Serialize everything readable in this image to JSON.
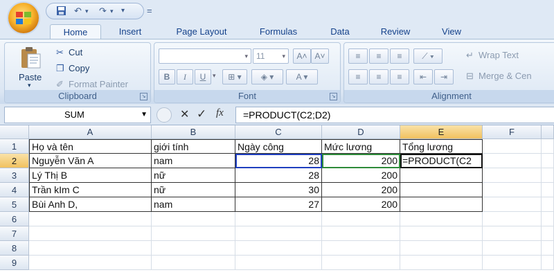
{
  "quick_access": {
    "undo": "↶",
    "redo": "↷",
    "customize": "="
  },
  "tabs": [
    {
      "label": "Home",
      "active": true
    },
    {
      "label": "Insert"
    },
    {
      "label": "Page Layout"
    },
    {
      "label": "Formulas"
    },
    {
      "label": "Data"
    },
    {
      "label": "Review"
    },
    {
      "label": "View"
    }
  ],
  "ribbon": {
    "clipboard": {
      "paste": "Paste",
      "cut": "Cut",
      "copy": "Copy",
      "format_painter": "Format Painter",
      "label": "Clipboard"
    },
    "font": {
      "font_name": "",
      "font_size": "11",
      "bold": "B",
      "italic": "I",
      "underline": "U",
      "label": "Font"
    },
    "alignment": {
      "wrap_text": "Wrap Text",
      "merge_center": "Merge & Cen",
      "label": "Alignment"
    }
  },
  "formula_bar": {
    "name_box": "SUM",
    "cancel": "✕",
    "enter": "✓",
    "fx": "fx",
    "formula": "=PRODUCT(C2;D2)"
  },
  "sheet": {
    "columns": [
      "A",
      "B",
      "C",
      "D",
      "E",
      "F"
    ],
    "rows": [
      "1",
      "2",
      "3",
      "4",
      "5",
      "6",
      "7",
      "8",
      "9"
    ],
    "header_row": [
      "Họ và tên",
      "giới tính",
      "Ngày công",
      "Mức lương",
      "Tổng lương"
    ],
    "data_rows": [
      [
        "Nguyễn Văn A",
        "nam",
        "28",
        "200",
        "=PRODUCT(C2"
      ],
      [
        "Lý Thị B",
        "nữ",
        "28",
        "200",
        ""
      ],
      [
        "Trần kIm C",
        "nữ",
        "30",
        "200",
        ""
      ],
      [
        "Bùi Anh D,",
        "nam",
        "27",
        "200",
        ""
      ]
    ],
    "active_cell": "E2"
  },
  "colors": {
    "accent": "#15428b",
    "selected_header": "#f1c15f",
    "range_c2": "#1f3fbf",
    "range_d2": "#2e8b3a"
  }
}
